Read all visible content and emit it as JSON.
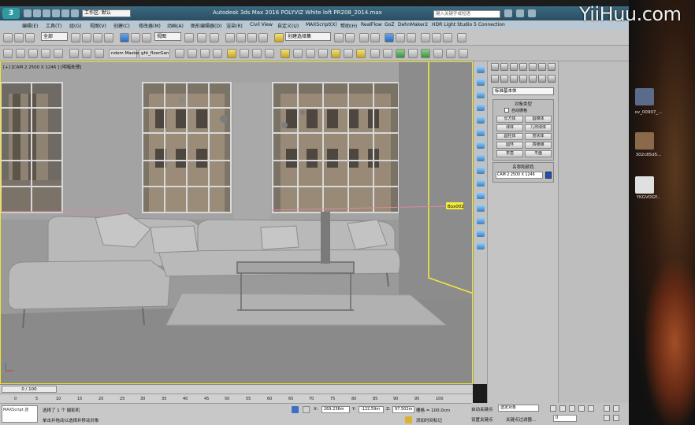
{
  "app": {
    "title": "Autodesk 3ds Max 2016    POLYVIZ White loft PR208_2014.max",
    "workspace": "工作区: 默认",
    "search_placeholder": "键入关键字或短语"
  },
  "menu": [
    "编辑(E)",
    "工具(T)",
    "组(G)",
    "视图(V)",
    "创建(C)",
    "修改器(M)",
    "动画(A)",
    "图形编辑器(D)",
    "渲染(R)",
    "Civil View",
    "自定义(U)",
    "MAXScript(X)",
    "帮助(H)",
    "RealFlow",
    "GoZ",
    "DehnMaker2",
    "HDR Light Studio 5 Connection"
  ],
  "toolbar1": {
    "selection_filter": "全部",
    "coord_system": "视图",
    "named_selection": "创建选择集"
  },
  "toolbar2": {
    "tab_random_master": "ndom Master",
    "tab_floor_generator": "ght_floorGen"
  },
  "viewport": {
    "label": "[+] [CAM 2 2500 X 1246 ] [明暗处理]",
    "object_tag": "Box002"
  },
  "timeline": {
    "thumb": "0 / 100",
    "ticks": [
      "0",
      "5",
      "10",
      "15",
      "20",
      "25",
      "30",
      "35",
      "40",
      "45",
      "50",
      "55",
      "60",
      "65",
      "70",
      "75",
      "80",
      "85",
      "90",
      "95",
      "100"
    ]
  },
  "status": {
    "maxscript_label": "MAXScript 迷",
    "selected_text": "选择了 1 个 摄影机",
    "prompt_text": "单击并拖动以选择并移动对象",
    "x_label": "X:",
    "x_value": "269.236m",
    "y_label": "Y:",
    "y_value": "-122.59m",
    "z_label": "Z:",
    "z_value": "97.502m",
    "grid_label": "栅格 = 100.0cm",
    "add_time_tag": "添加时间标记",
    "auto_key": "自动关键点",
    "selected_option": "选定对象",
    "set_key": "设置关键点",
    "key_filters": "关键点过滤器...",
    "frame_value": "0"
  },
  "command_panel": {
    "category": "标准基本体",
    "object_type_title": "对象类型",
    "autogrid": "自动栅格",
    "objects": [
      "长方体",
      "圆锥体",
      "球体",
      "几何球体",
      "圆柱体",
      "管状体",
      "圆环",
      "四棱锥",
      "茶壶",
      "平面"
    ],
    "name_color_title": "名称和颜色",
    "name_value": "CAM 2 2500 X 1246",
    "object_color": "#1e4fbf"
  },
  "desktop": {
    "watermark": "YiiHuu.com",
    "icons": [
      {
        "label": "ov_00907_...",
        "color": "#5b6c8a"
      },
      {
        "label": "302c85d5...",
        "color": "#8a6a4a"
      },
      {
        "label": "YKGVOGY...",
        "color": "#e0e0e0"
      }
    ]
  }
}
